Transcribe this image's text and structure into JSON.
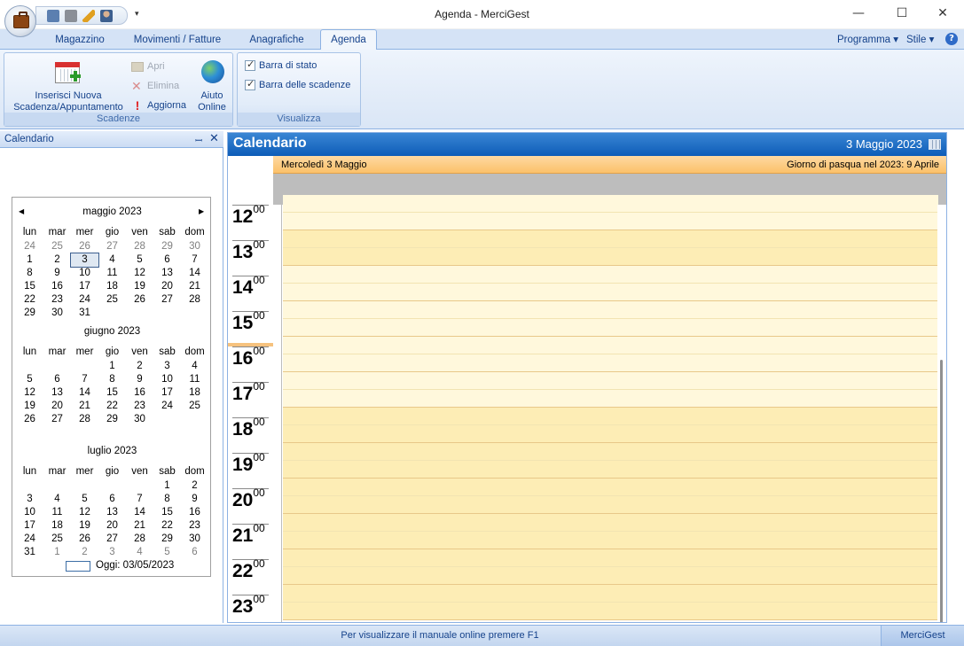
{
  "window": {
    "title": "Agenda - MerciGest",
    "minimize": "—",
    "maximize": "☐",
    "close": "✕",
    "qat_more": "▾"
  },
  "tabs": [
    {
      "label": "Magazzino"
    },
    {
      "label": "Movimenti / Fatture"
    },
    {
      "label": "Anagrafiche"
    },
    {
      "label": "Agenda",
      "active": true
    }
  ],
  "right_menu": {
    "programma": "Programma ▾",
    "stile": "Stile ▾",
    "help": "?"
  },
  "ribbon": {
    "scadenze": {
      "label": "Scadenze",
      "new_label_line1": "Inserisci Nuova",
      "new_label_line2": "Scadenza/Appuntamento",
      "apri": "Apri",
      "elimina": "Elimina",
      "aggiorna": "Aggiorna",
      "aiuto_line1": "Aiuto",
      "aiuto_line2": "Online"
    },
    "visualizza": {
      "label": "Visualizza",
      "barra_stato": "Barra di stato",
      "barra_scadenze": "Barra delle scadenze"
    }
  },
  "left_panel": {
    "title": "Calendario",
    "pin": "ꟷ",
    "close": "✕",
    "nav_prev": "◀",
    "nav_next": "▶",
    "dow": [
      "lun",
      "mar",
      "mer",
      "gio",
      "ven",
      "sab",
      "dom"
    ],
    "months": [
      {
        "title": "maggio 2023",
        "weeks": [
          [
            "24",
            "25",
            "26",
            "27",
            "28",
            "29",
            "30"
          ],
          [
            "1",
            "2",
            "3",
            "4",
            "5",
            "6",
            "7"
          ],
          [
            "8",
            "9",
            "10",
            "11",
            "12",
            "13",
            "14"
          ],
          [
            "15",
            "16",
            "17",
            "18",
            "19",
            "20",
            "21"
          ],
          [
            "22",
            "23",
            "24",
            "25",
            "26",
            "27",
            "28"
          ],
          [
            "29",
            "30",
            "31",
            "",
            "",
            "",
            ""
          ]
        ]
      },
      {
        "title": "giugno 2023",
        "weeks": [
          [
            "",
            "",
            "",
            "1",
            "2",
            "3",
            "4"
          ],
          [
            "5",
            "6",
            "7",
            "8",
            "9",
            "10",
            "11"
          ],
          [
            "12",
            "13",
            "14",
            "15",
            "16",
            "17",
            "18"
          ],
          [
            "19",
            "20",
            "21",
            "22",
            "23",
            "24",
            "25"
          ],
          [
            "26",
            "27",
            "28",
            "29",
            "30",
            "",
            ""
          ]
        ]
      },
      {
        "title": "luglio 2023",
        "weeks": [
          [
            "",
            "",
            "",
            "",
            "",
            "1",
            "2"
          ],
          [
            "3",
            "4",
            "5",
            "6",
            "7",
            "8",
            "9"
          ],
          [
            "10",
            "11",
            "12",
            "13",
            "14",
            "15",
            "16"
          ],
          [
            "17",
            "18",
            "19",
            "20",
            "21",
            "22",
            "23"
          ],
          [
            "24",
            "25",
            "26",
            "27",
            "28",
            "29",
            "30"
          ],
          [
            "31",
            "1",
            "2",
            "3",
            "4",
            "5",
            "6"
          ]
        ]
      }
    ],
    "today_label": "Oggi: 03/05/2023"
  },
  "calendar": {
    "title": "Calendario",
    "date": "3 Maggio 2023",
    "day_label": "Mercoledì 3  Maggio",
    "holiday": "Giorno di pasqua nel 2023: 9 Aprile",
    "hours": [
      "12",
      "13",
      "14",
      "15",
      "16",
      "17",
      "18",
      "19",
      "20",
      "21",
      "22",
      "23"
    ],
    "minutes": "00"
  },
  "status": {
    "text": "Per visualizzare il manuale online premere F1",
    "app": "MerciGest"
  },
  "colors": {
    "accent": "#15428b",
    "header_blue": "#0d5cb8",
    "day_header": "#fbc16a",
    "work_slot": "#fff8dc",
    "off_slot": "#fdedb5"
  }
}
